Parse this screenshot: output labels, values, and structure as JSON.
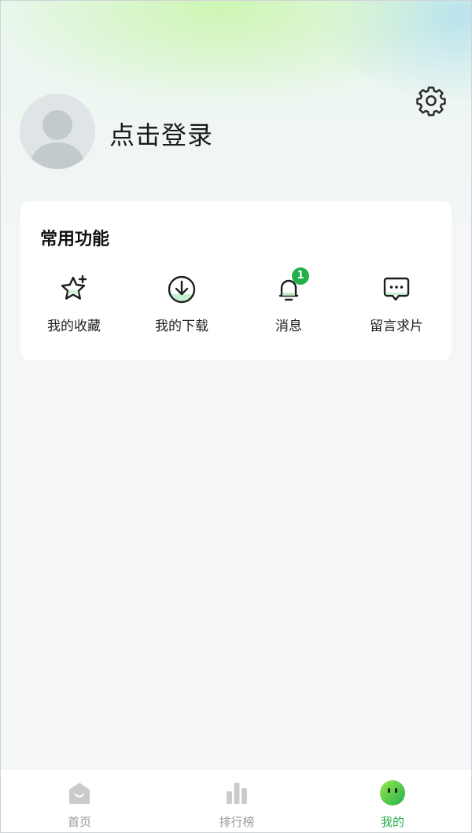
{
  "header": {
    "login_text": "点击登录"
  },
  "common": {
    "title": "常用功能",
    "items": [
      {
        "label": "我的收藏",
        "icon": "star-plus-icon"
      },
      {
        "label": "我的下载",
        "icon": "download-icon"
      },
      {
        "label": "消息",
        "icon": "bell-icon",
        "badge": "1"
      },
      {
        "label": "留言求片",
        "icon": "message-icon"
      }
    ]
  },
  "tabbar": {
    "tabs": [
      {
        "label": "首页",
        "icon": "home-icon"
      },
      {
        "label": "排行榜",
        "icon": "ranking-icon"
      },
      {
        "label": "我的",
        "icon": "profile-face-icon",
        "active": true
      }
    ]
  },
  "colors": {
    "accent": "#22b04a",
    "inactive": "#9a9a9a"
  }
}
